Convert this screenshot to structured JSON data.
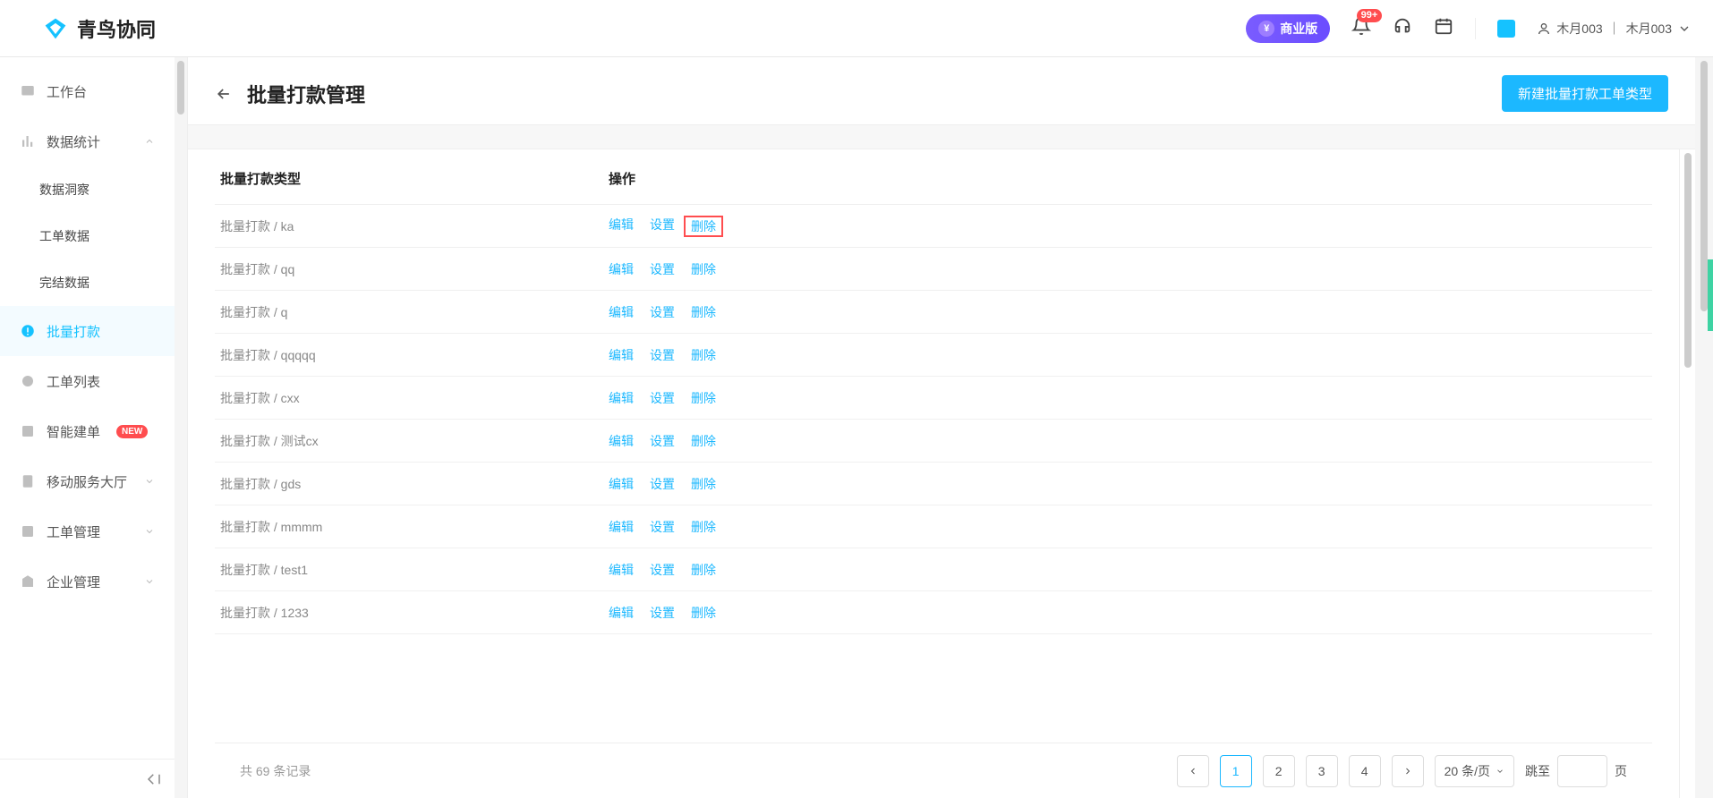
{
  "brand": {
    "name": "青鸟协同"
  },
  "header": {
    "biz_label": "商业版",
    "bell_badge": "99+",
    "user_primary": "木月003",
    "user_secondary": "木月003"
  },
  "sidebar": {
    "workbench": "工作台",
    "stats": "数据统计",
    "insight": "数据洞察",
    "order_data": "工单数据",
    "finish_data": "完结数据",
    "batch_pay": "批量打款",
    "order_list": "工单列表",
    "smart_order": "智能建单",
    "smart_order_badge": "NEW",
    "mobile_hall": "移动服务大厅",
    "order_mgmt": "工单管理",
    "corp_mgmt": "企业管理"
  },
  "page": {
    "title": "批量打款管理",
    "create_btn": "新建批量打款工单类型"
  },
  "table": {
    "col_type": "批量打款类型",
    "col_ops": "操作",
    "ops": {
      "edit": "编辑",
      "settings": "设置",
      "delete": "删除"
    },
    "rows": [
      {
        "name": "批量打款 / ka",
        "highlight_delete": true
      },
      {
        "name": "批量打款 / qq",
        "highlight_delete": false
      },
      {
        "name": "批量打款 / q",
        "highlight_delete": false
      },
      {
        "name": "批量打款 / qqqqq",
        "highlight_delete": false
      },
      {
        "name": "批量打款 / cxx",
        "highlight_delete": false
      },
      {
        "name": "批量打款 / 测试cx",
        "highlight_delete": false
      },
      {
        "name": "批量打款 / gds",
        "highlight_delete": false
      },
      {
        "name": "批量打款 / mmmm",
        "highlight_delete": false
      },
      {
        "name": "批量打款 / test1",
        "highlight_delete": false
      },
      {
        "name": "批量打款 / 1233",
        "highlight_delete": false
      }
    ]
  },
  "footer": {
    "total_prefix": "共 ",
    "total_count": "69",
    "total_suffix": " 条记录",
    "pages": [
      "1",
      "2",
      "3",
      "4"
    ],
    "active_page": "1",
    "page_size_label": "20 条/页",
    "jump_prefix": "跳至",
    "jump_suffix": "页"
  }
}
